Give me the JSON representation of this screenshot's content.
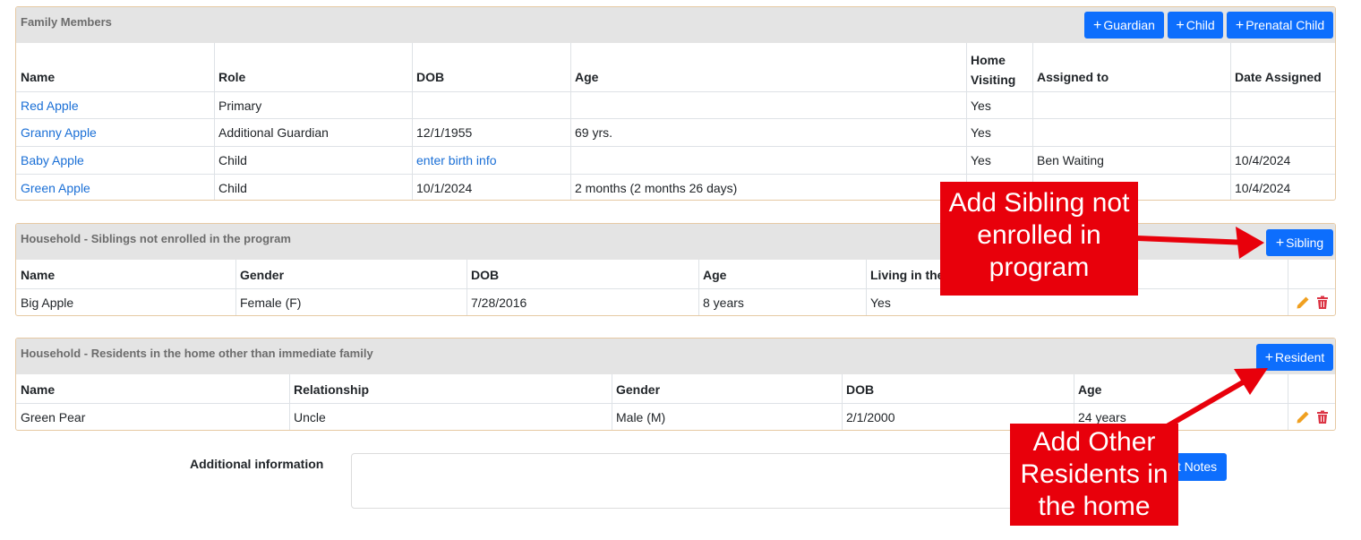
{
  "family": {
    "title": "Family Members",
    "buttons": [
      "Guardian",
      "Child",
      "Prenatal Child"
    ],
    "headers": [
      "Name",
      "Role",
      "DOB",
      "Age",
      "Home\nVisiting",
      "Assigned to",
      "Date Assigned"
    ],
    "rows": [
      [
        "Red Apple",
        "Primary",
        "",
        "",
        "Yes",
        "",
        ""
      ],
      [
        "Granny Apple",
        "Additional Guardian",
        "12/1/1955",
        "69 yrs.",
        "Yes",
        "",
        ""
      ],
      [
        "Baby Apple",
        "Child",
        "enter birth info",
        "",
        "Yes",
        "Ben Waiting",
        "10/4/2024"
      ],
      [
        "Green Apple",
        "Child",
        "10/1/2024",
        "2 months (2 months 26 days)",
        "",
        "",
        "10/4/2024"
      ]
    ]
  },
  "siblings": {
    "title": "Household - Siblings not enrolled in the program",
    "button": "Sibling",
    "headers": [
      "Name",
      "Gender",
      "DOB",
      "Age",
      "Living in the"
    ],
    "rows": [
      [
        "Big Apple",
        "Female (F)",
        "7/28/2016",
        "8 years",
        "Yes"
      ]
    ]
  },
  "residents": {
    "title": "Household - Residents in the home other than immediate family",
    "button": "Resident",
    "headers": [
      "Name",
      "Relationship",
      "Gender",
      "DOB",
      "Age"
    ],
    "rows": [
      [
        "Green Pear",
        "Uncle",
        "Male (M)",
        "2/1/2000",
        "24 years"
      ]
    ]
  },
  "additional": {
    "label": "Additional information",
    "value": "",
    "notes_button": "t Notes"
  },
  "callouts": {
    "sibling": "Add Sibling not enrolled in program",
    "resident": "Add Other Residents in the home"
  },
  "icons": {
    "edit": "pencil-icon",
    "delete": "trash-icon",
    "plus": "plus-icon"
  },
  "colors": {
    "primary": "#0d6efd",
    "link": "#1a6fd6",
    "callout": "#e8000b",
    "edit_icon": "#f0a020",
    "delete_icon": "#dc3545"
  }
}
